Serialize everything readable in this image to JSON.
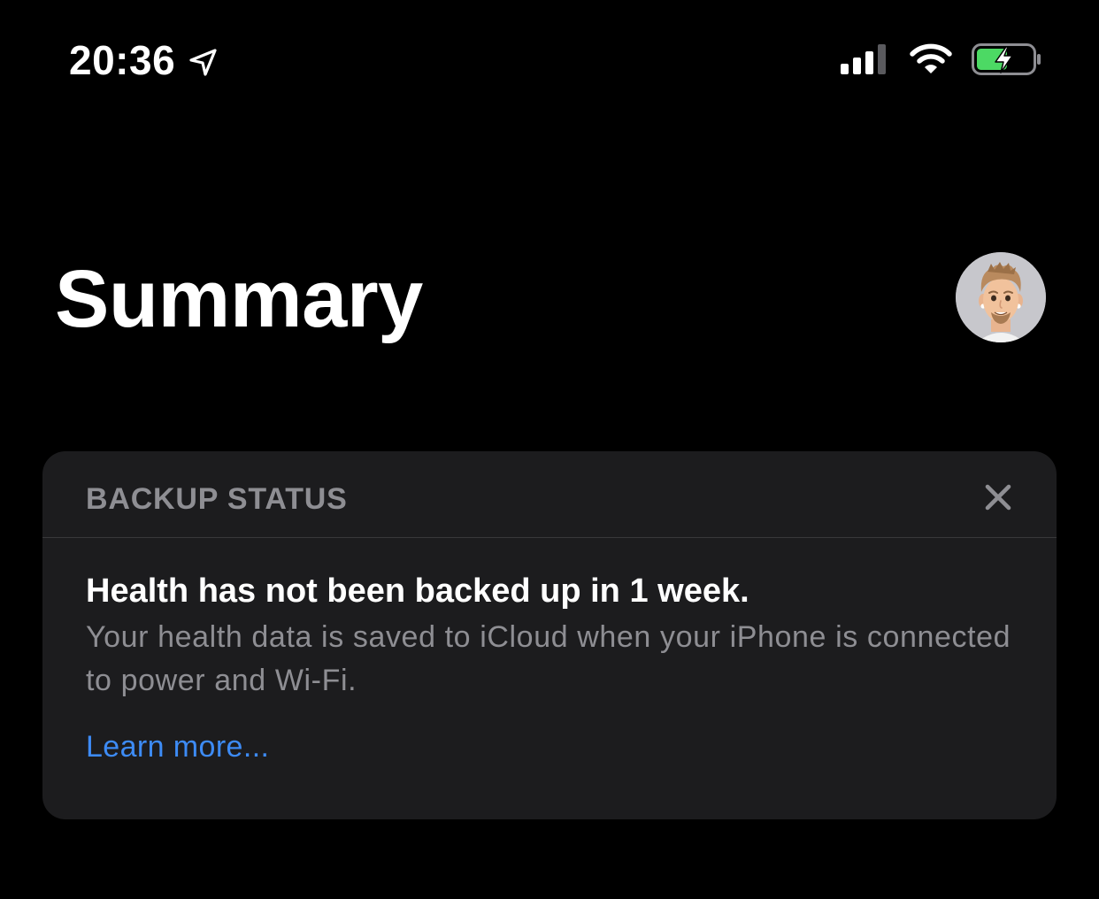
{
  "status_bar": {
    "time": "20:36",
    "icons": {
      "location": "location-arrow-icon",
      "signal": "cellular-signal-icon",
      "wifi": "wifi-icon",
      "battery": "battery-charging-icon"
    },
    "battery_level": 0.55,
    "colors": {
      "battery_fill": "#4cd964",
      "icon": "#ffffff"
    }
  },
  "header": {
    "title": "Summary",
    "avatar_icon": "memoji-avatar-icon"
  },
  "backup_card": {
    "section_title": "BACKUP STATUS",
    "close_icon": "close-icon",
    "headline": "Health has not been backed up in 1 week.",
    "description": "Your health data is saved to iCloud when your iPhone is connected to power and Wi-Fi.",
    "link_label": "Learn more...",
    "colors": {
      "background": "#1c1c1e",
      "secondary_text": "#8e8e93",
      "link": "#3d8bf5"
    }
  }
}
